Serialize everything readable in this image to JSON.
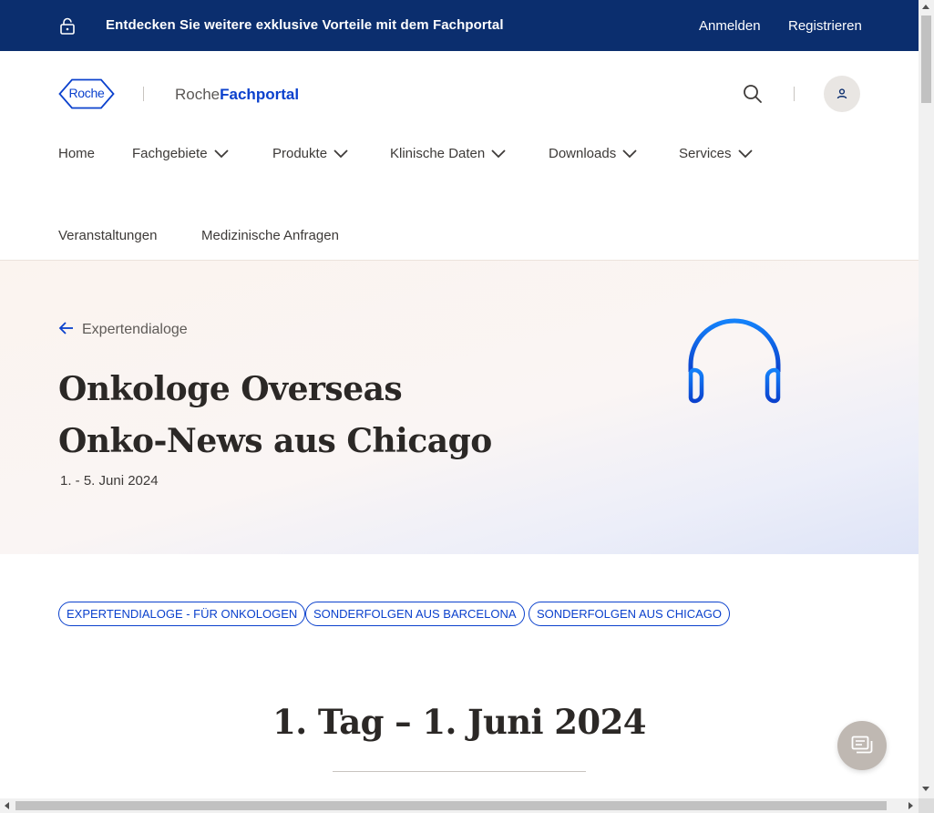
{
  "topbar": {
    "promo": "Entdecken Sie weitere exklusive Vorteile mit dem Fachportal",
    "login": "Anmelden",
    "register": "Registrieren"
  },
  "header": {
    "logo_text": "Roche",
    "brand_prefix": "Roche",
    "brand_suffix": "Fachportal"
  },
  "nav": {
    "home": "Home",
    "fachgebiete": "Fachgebiete",
    "produkte": "Produkte",
    "klinische_daten": "Klinische Daten",
    "downloads": "Downloads",
    "services": "Services",
    "veranstaltungen": "Veranstaltungen",
    "anfragen": "Medizinische Anfragen"
  },
  "hero": {
    "back_label": "Expertendialoge",
    "title_line1": "Onkologe Overseas",
    "title_line2": "Onko-News aus Chicago",
    "date": "1. - 5. Juni 2024"
  },
  "tags": [
    "EXPERTENDIALOGE - FÜR ONKOLOGEN",
    "SONDERFOLGEN AUS BARCELONA",
    "SONDERFOLGEN AUS CHICAGO"
  ],
  "section": {
    "day_title": "1. Tag – 1. Juni 2024"
  },
  "colors": {
    "brand_blue": "#0b41cd",
    "banner_navy": "#0b2e6e"
  },
  "icons": [
    "lock-open-icon",
    "search-icon",
    "user-icon",
    "chevron-down-icon",
    "arrow-left-icon",
    "headphones-icon",
    "chat-icon"
  ]
}
